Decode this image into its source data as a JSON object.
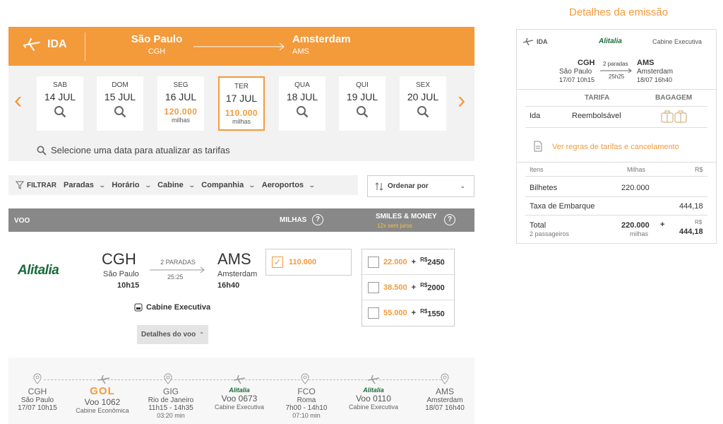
{
  "route": {
    "direction": "IDA",
    "origin_city": "São Paulo",
    "origin_code": "CGH",
    "dest_city": "Amsterdam",
    "dest_code": "AMS"
  },
  "dates": [
    {
      "weekday": "SAB",
      "date": "14 JUL",
      "price": "",
      "unit": ""
    },
    {
      "weekday": "DOM",
      "date": "15 JUL",
      "price": "",
      "unit": ""
    },
    {
      "weekday": "SEG",
      "date": "16 JUL",
      "price": "120.000",
      "unit": "milhas"
    },
    {
      "weekday": "TER",
      "date": "17 JUL",
      "price": "110.000",
      "unit": "milhas"
    },
    {
      "weekday": "QUA",
      "date": "18 JUL",
      "price": "",
      "unit": ""
    },
    {
      "weekday": "QUI",
      "date": "19 JUL",
      "price": "",
      "unit": ""
    },
    {
      "weekday": "SEX",
      "date": "20 JUL",
      "price": "",
      "unit": ""
    }
  ],
  "selected_date_index": 3,
  "date_hint": "Selecione uma data para atualizar as tarifas",
  "filters": {
    "filtrar": "FILTRAR",
    "items": [
      "Paradas",
      "Horário",
      "Cabine",
      "Companhia",
      "Aeroportos"
    ],
    "sort_label": "Ordenar por"
  },
  "table_header": {
    "voo": "VOO",
    "milhas": "MILHAS",
    "smiles_money": "SMILES & MONEY",
    "installments": "12x sem juros"
  },
  "flight": {
    "airline": "Alitalia",
    "dep_code": "CGH",
    "dep_city": "São Paulo",
    "dep_time": "10h15",
    "stops": "2 PARADAS",
    "duration": "25:25",
    "arr_code": "AMS",
    "arr_city": "Amsterdam",
    "arr_time": "16h40",
    "cabin": "Cabine Executiva",
    "details_label": "Detalhes do voo",
    "miles_option": "110.000",
    "smiles_money_options": [
      {
        "miles": "22.000",
        "currency": "R$",
        "money": "2450"
      },
      {
        "miles": "38.500",
        "currency": "R$",
        "money": "2000"
      },
      {
        "miles": "55.000",
        "currency": "R$",
        "money": "1550"
      }
    ]
  },
  "itinerary": {
    "stops": [
      {
        "code": "CGH",
        "city": "São Paulo",
        "time": "17/07 10h15",
        "extra": ""
      },
      {
        "code": "GIG",
        "city": "Rio de Janeiro",
        "time": "11h15 - 14h35",
        "extra": "03:20 min"
      },
      {
        "code": "FCO",
        "city": "Roma",
        "time": "7h00 - 14h10",
        "extra": "07:10 min"
      },
      {
        "code": "AMS",
        "city": "Amsterdam",
        "time": "18/07 16h40",
        "extra": ""
      }
    ],
    "legs": [
      {
        "airline": "GOL",
        "flight": "Voo 1062",
        "cabin": "Cabine Econômica"
      },
      {
        "airline": "Alitalia",
        "flight": "Voo 0673",
        "cabin": "Cabine Executiva"
      },
      {
        "airline": "Alitalia",
        "flight": "Voo 0110",
        "cabin": "Cabine Executiva"
      }
    ]
  },
  "summary": {
    "title": "Detalhes da emissão",
    "direction": "IDA",
    "airline": "Alitalia",
    "cabin": "Cabine Executiva",
    "dep_code": "CGH",
    "dep_city": "São Paulo",
    "dep_datetime": "17/07 10h15",
    "stops": "2 paradas",
    "duration": "25h25",
    "arr_code": "AMS",
    "arr_city": "Amsterdam",
    "arr_datetime": "18/07 16h40",
    "col_tarifa": "TARIFA",
    "col_bagagem": "BAGAGEM",
    "fare_leg": "Ida",
    "fare_type": "Reembolsável",
    "rules_link": "Ver regras de tarifas e cancelamento",
    "col_itens": "Itens",
    "col_milhas": "Milhas",
    "col_rs": "R$",
    "row1_label": "Bilhetes",
    "row1_miles": "220.000",
    "row2_label": "Taxa de Embarque",
    "row2_rs": "444,18",
    "total_label": "Total",
    "total_sub": "2 passageiros",
    "total_miles": "220.000",
    "total_miles_unit": "milhas",
    "plus": "+",
    "total_rs_cur": "R$",
    "total_rs": "444,18"
  },
  "colors": {
    "accent": "#f39a3b",
    "header_gray": "#888888",
    "alitalia_green": "#1a6b3c"
  }
}
